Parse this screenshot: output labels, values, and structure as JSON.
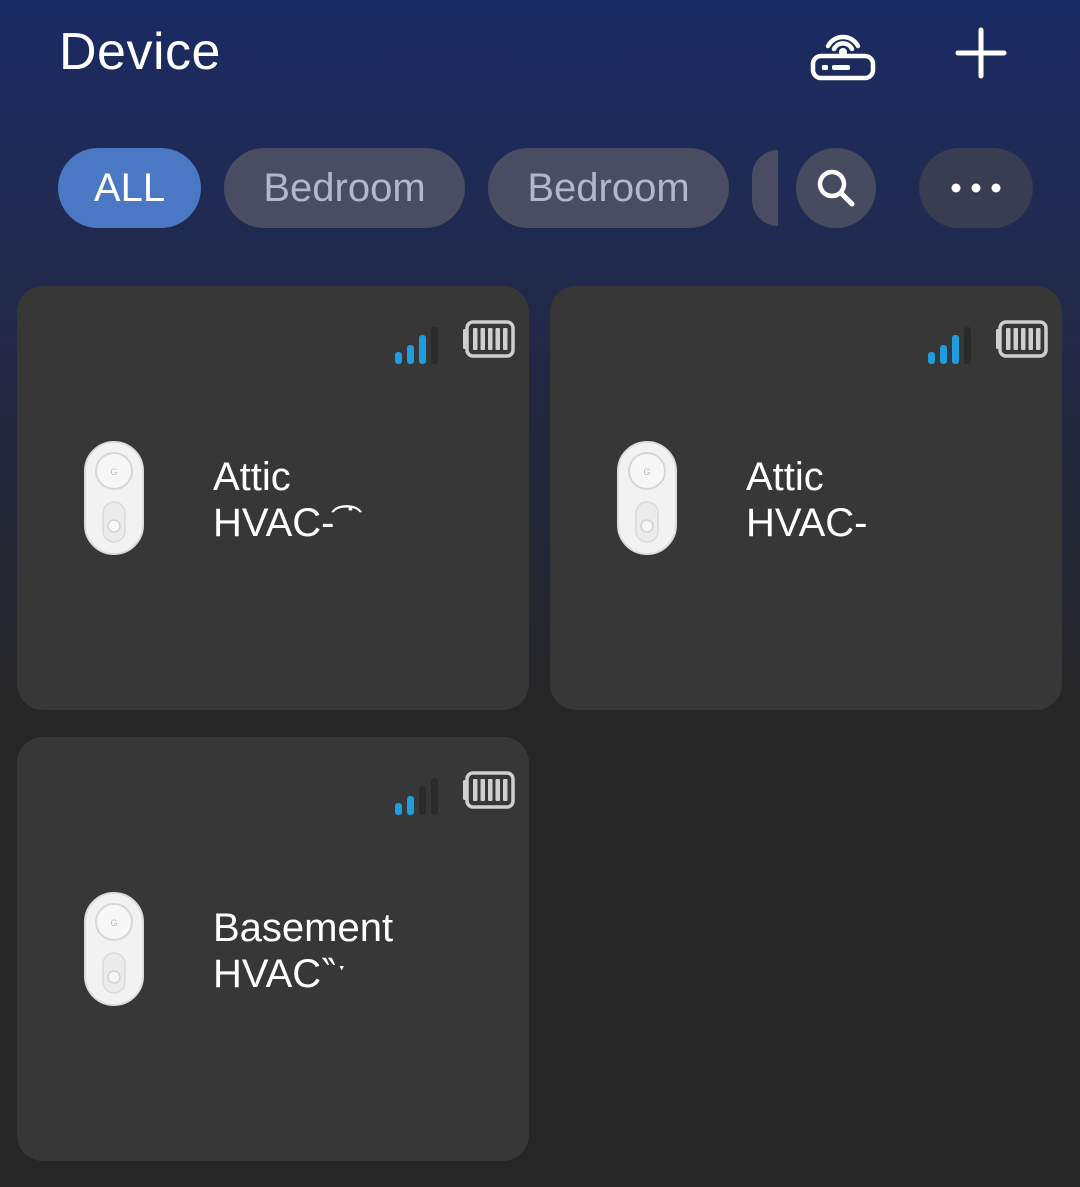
{
  "header": {
    "title": "Device",
    "hub_icon": "hub-router-icon",
    "add_icon": "plus-icon"
  },
  "filters": {
    "chips": [
      {
        "label": "ALL",
        "active": true
      },
      {
        "label": "Bedroom",
        "active": false
      },
      {
        "label": "Bedroom",
        "active": false
      }
    ],
    "search_icon": "search-icon",
    "more_icon": "more-dots-icon"
  },
  "devices": [
    {
      "line1": "Attic",
      "line2": "HVAC-͡ ˙",
      "signal_bars_active": 3,
      "signal_bars_total": 4,
      "battery_level": 1.0
    },
    {
      "line1": "Attic",
      "line2": "HVAC-",
      "signal_bars_active": 3,
      "signal_bars_total": 4,
      "battery_level": 1.0
    },
    {
      "line1": "Basement",
      "line2": "HVAC‶ˑ",
      "signal_bars_active": 2,
      "signal_bars_total": 4,
      "battery_level": 1.0
    }
  ],
  "colors": {
    "accent": "#4a78c4",
    "signal": "#1e9ee0",
    "card": "#373737",
    "chip_inactive": "#4a4d62"
  }
}
